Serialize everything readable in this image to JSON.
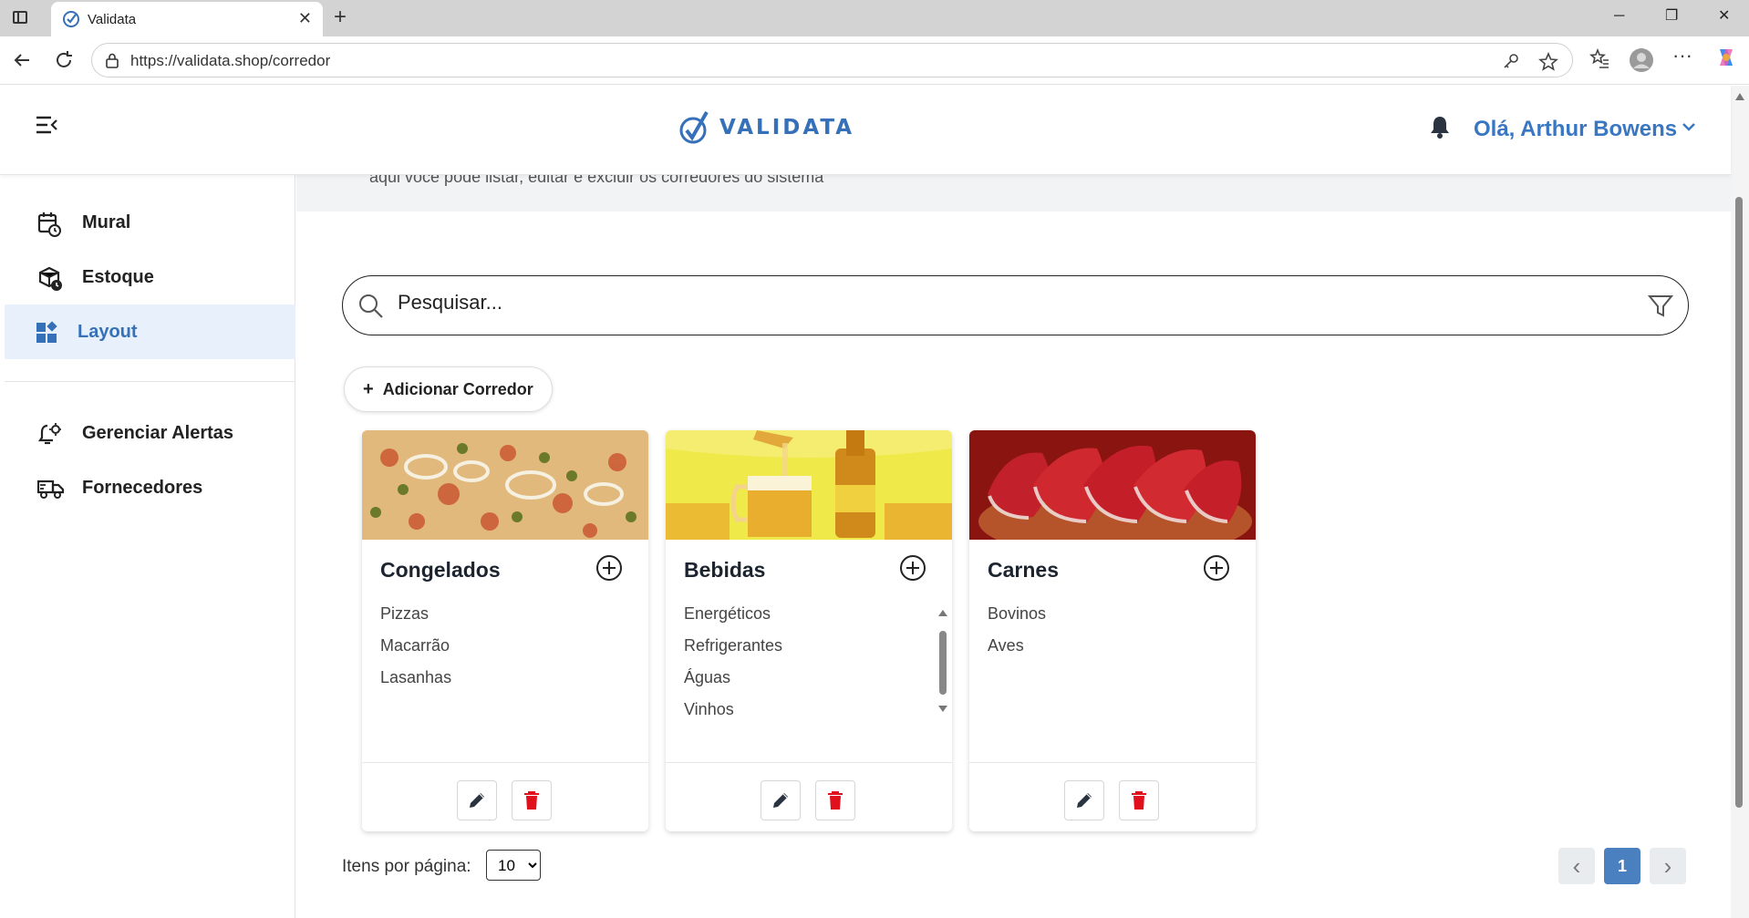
{
  "browser": {
    "tab_title": "Validata",
    "tab_close": "✕",
    "new_tab": "+",
    "url": "https://validata.shop/corredor",
    "window_controls": {
      "minimize": "─",
      "restore": "❐",
      "close": "✕"
    },
    "more": "···"
  },
  "header": {
    "logo_text": "VALIDATA",
    "greeting": "Olá, Arthur Bowens"
  },
  "sidebar": {
    "items": [
      {
        "label": "Mural",
        "icon": "calendar-clock-icon"
      },
      {
        "label": "Estoque",
        "icon": "box-clock-icon"
      },
      {
        "label": "Layout",
        "icon": "dashboard-grid-icon",
        "active": true
      },
      {
        "label": "Gerenciar Alertas",
        "icon": "bell-settings-icon"
      },
      {
        "label": "Fornecedores",
        "icon": "truck-icon"
      }
    ]
  },
  "main": {
    "band_text": "aqui você pode listar, editar e excluir os corredores do sistema",
    "search_placeholder": "Pesquisar...",
    "add_button": "Adicionar Corredor",
    "cards": [
      {
        "title": "Congelados",
        "items": [
          "Pizzas",
          "Macarrão",
          "Lasanhas"
        ]
      },
      {
        "title": "Bebidas",
        "items": [
          "Energéticos",
          "Refrigerantes",
          "Águas",
          "Vinhos"
        ]
      },
      {
        "title": "Carnes",
        "items": [
          "Bovinos",
          "Aves"
        ]
      }
    ],
    "pagination": {
      "per_page_label": "Itens por página:",
      "per_page_value": "10",
      "current_page": "1",
      "prev": "‹",
      "next": "›"
    }
  },
  "colors": {
    "brand": "#3570b8",
    "active_bg": "#e8f0fb",
    "delete": "#e0101c",
    "page_active": "#4a7fc0"
  }
}
